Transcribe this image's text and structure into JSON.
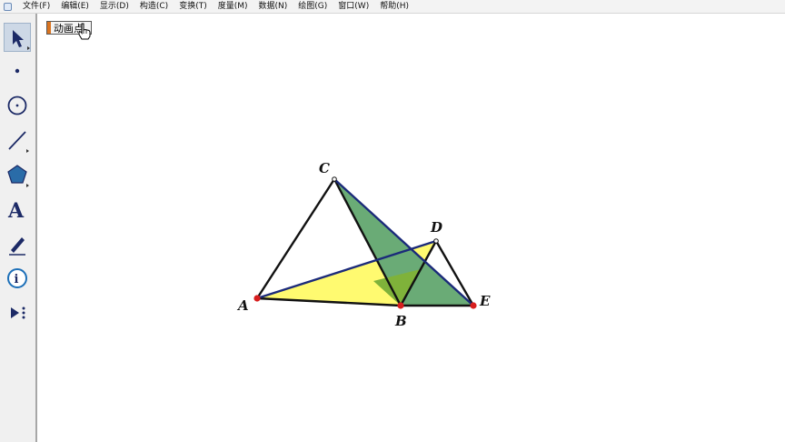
{
  "menu": {
    "app_icon": "sketchpad-app-icon",
    "items": [
      "文件(F)",
      "编辑(E)",
      "显示(D)",
      "构造(C)",
      "变换(T)",
      "度量(M)",
      "数据(N)",
      "绘图(G)",
      "窗口(W)",
      "帮助(H)"
    ]
  },
  "toolbar": {
    "tools": [
      "arrow-select-icon",
      "point-icon",
      "compass-icon",
      "straightedge-icon",
      "polygon-icon",
      "text-icon",
      "marker-icon",
      "information-icon",
      "custom-tools-icon"
    ],
    "text_tool_glyph": "A",
    "selected": "arrow-select-icon"
  },
  "canvas": {
    "animate_button_label": "动画点",
    "points": [
      "A",
      "B",
      "C",
      "D",
      "E"
    ],
    "colors": {
      "triangle_abd_fill": "#fffa70",
      "triangle_cbe_fill": "#6aab76",
      "overlap_fill": "#7fb23a",
      "segment_dark": "#111111",
      "segment_blue": "#1b2a7a",
      "point_red": "#d81e1e"
    }
  }
}
